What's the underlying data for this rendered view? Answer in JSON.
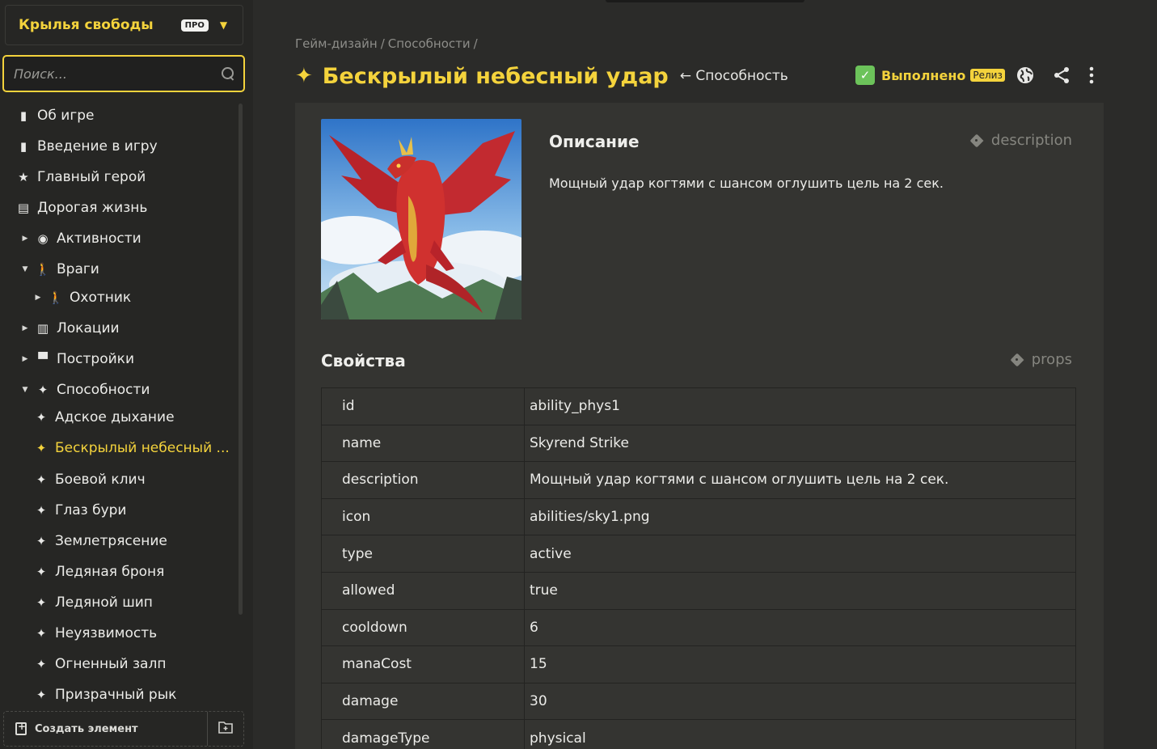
{
  "sidebar": {
    "project_title": "Крылья свободы",
    "pro_badge": "ПРО",
    "search_placeholder": "Поиск...",
    "items": [
      {
        "label": "Об игре",
        "icon": "book-icon",
        "arrow": ""
      },
      {
        "label": "Введение в игру",
        "icon": "book-icon",
        "arrow": ""
      },
      {
        "label": "Главный герой",
        "icon": "star-icon",
        "arrow": ""
      },
      {
        "label": "Дорогая жизнь",
        "icon": "book-stack-icon",
        "arrow": ""
      },
      {
        "label": "Активности",
        "icon": "activity-icon",
        "arrow": "collapsed"
      },
      {
        "label": "Враги",
        "icon": "walker-icon",
        "arrow": "expanded"
      },
      {
        "label": "Охотник",
        "icon": "walker-icon",
        "arrow": ""
      },
      {
        "label": "Локации",
        "icon": "map-icon",
        "arrow": "collapsed"
      },
      {
        "label": "Постройки",
        "icon": "store-icon",
        "arrow": "collapsed"
      },
      {
        "label": "Способности",
        "icon": "sparkles-icon",
        "arrow": "expanded"
      },
      {
        "label": "Адское дыхание",
        "icon": "sparkles-icon",
        "arrow": ""
      },
      {
        "label": "Бескрылый небесный ...",
        "icon": "sparkles-icon",
        "arrow": "",
        "active": true
      },
      {
        "label": "Боевой клич",
        "icon": "sparkles-icon",
        "arrow": ""
      },
      {
        "label": "Глаз бури",
        "icon": "sparkles-icon",
        "arrow": ""
      },
      {
        "label": "Землетрясение",
        "icon": "sparkles-icon",
        "arrow": ""
      },
      {
        "label": "Ледяная броня",
        "icon": "sparkles-icon",
        "arrow": ""
      },
      {
        "label": "Ледяной шип",
        "icon": "sparkles-icon",
        "arrow": ""
      },
      {
        "label": "Неуязвимость",
        "icon": "sparkles-icon",
        "arrow": ""
      },
      {
        "label": "Огненный залп",
        "icon": "sparkles-icon",
        "arrow": ""
      },
      {
        "label": "Призрачный рык",
        "icon": "sparkles-icon",
        "arrow": ""
      }
    ],
    "create_label": "Создать элемент"
  },
  "header": {
    "breadcrumb": [
      "Гейм-дизайн",
      "/",
      "Способности",
      "/"
    ],
    "title": "Бескрылый небесный удар",
    "back_link": "← Способность",
    "status": "Выполнено",
    "release_badge": "Релиз"
  },
  "description": {
    "heading": "Описание",
    "tag": "description",
    "text": "Мощный удар когтями с шансом оглушить цель на 2 сек."
  },
  "props": {
    "heading": "Свойства",
    "tag": "props",
    "rows": [
      {
        "key": "id",
        "value": "ability_phys1"
      },
      {
        "key": "name",
        "value": "Skyrend Strike"
      },
      {
        "key": "description",
        "value": "Мощный удар когтями с шансом оглушить цель на 2 сек."
      },
      {
        "key": "icon",
        "value": "abilities/sky1.png"
      },
      {
        "key": "type",
        "value": "active"
      },
      {
        "key": "allowed",
        "value": "true"
      },
      {
        "key": "cooldown",
        "value": "6"
      },
      {
        "key": "manaCost",
        "value": "15"
      },
      {
        "key": "damage",
        "value": "30"
      },
      {
        "key": "damageType",
        "value": "physical"
      }
    ]
  },
  "colors": {
    "accent": "#f4d33c",
    "status_green": "#6cc35a",
    "background": "#2b2b29",
    "card": "#343431"
  }
}
